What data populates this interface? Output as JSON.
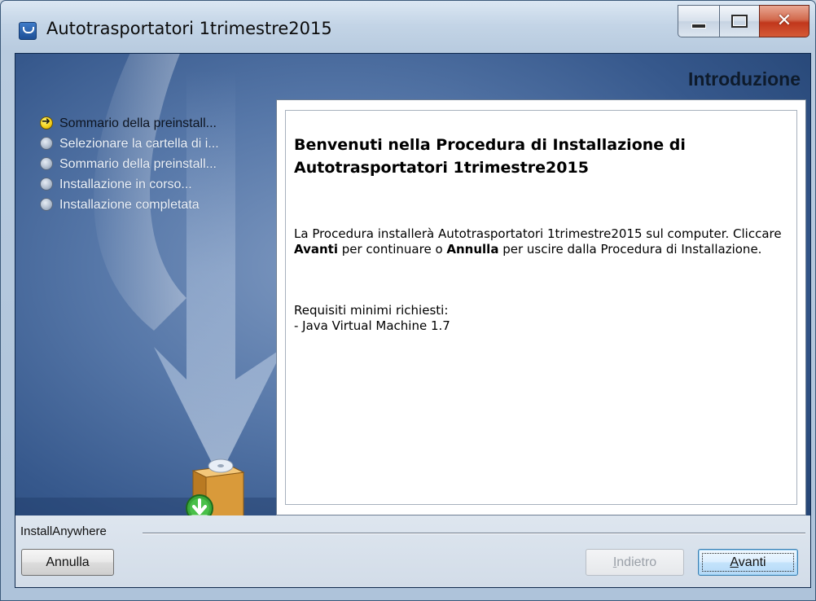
{
  "window": {
    "title": "Autotrasportatori 1trimestre2015",
    "icons": {
      "app": "app-icon",
      "minimize": "minimize-icon",
      "maximize": "maximize-icon",
      "close": "close-icon"
    }
  },
  "header": {
    "title": "Introduzione"
  },
  "steps": [
    {
      "label": "Sommario della preinstall...",
      "state": "current"
    },
    {
      "label": "Selezionare la cartella di i...",
      "state": "pending"
    },
    {
      "label": "Sommario della preinstall...",
      "state": "pending"
    },
    {
      "label": "Installazione in corso...",
      "state": "pending"
    },
    {
      "label": "Installazione completata",
      "state": "pending"
    }
  ],
  "content": {
    "heading": "Benvenuti nella Procedura di Installazione di Autotrasportatori 1trimestre2015",
    "para_1": "La Procedura installerà Autotrasportatori 1trimestre2015 sul computer. Cliccare ",
    "para_bold_1": "Avanti",
    "para_2": " per continuare o ",
    "para_bold_2": "Annulla",
    "para_3": " per uscire dalla Procedura di Installazione.",
    "requirements_title": "Requisiti minimi richiesti:",
    "requirements_item": "- Java Virtual Machine 1.7"
  },
  "footer": {
    "brand": "InstallAnywhere",
    "cancel_label": "Annulla",
    "back_mnemonic": "I",
    "back_rest": "ndietro",
    "next_mnemonic": "A",
    "next_rest": "vanti"
  },
  "colors": {
    "panel_blue": "#214a82",
    "accent_yellow": "#f4d21c",
    "close_red": "#c1371c",
    "install_green": "#3aa83a"
  }
}
